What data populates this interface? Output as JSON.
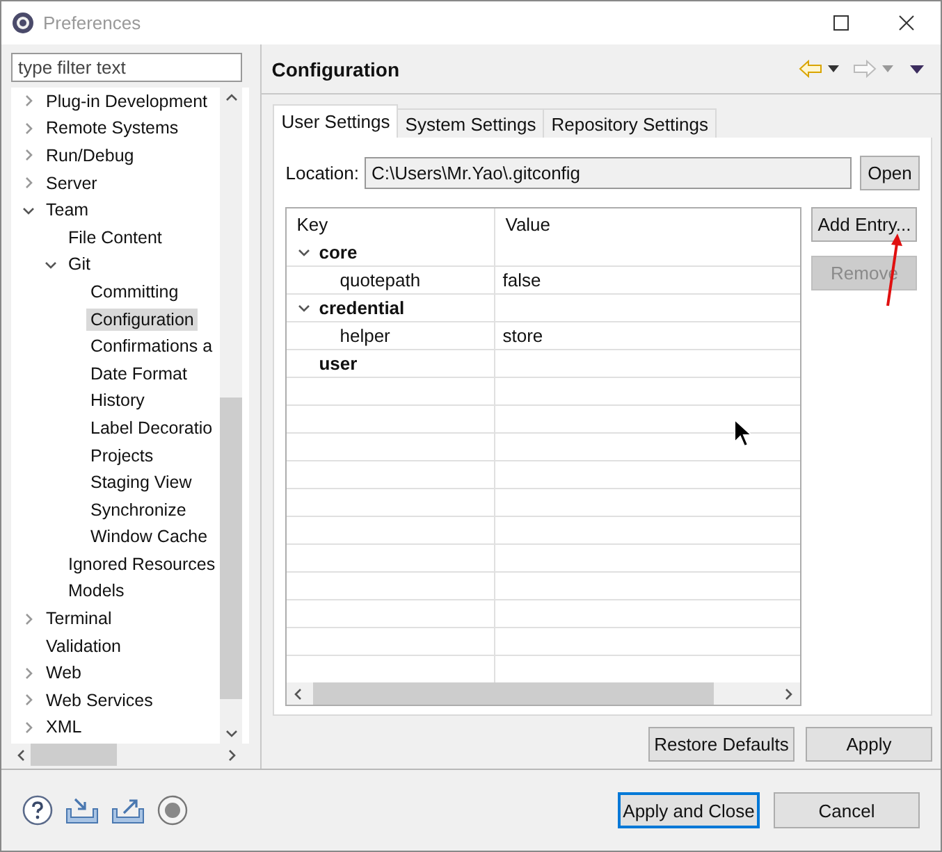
{
  "window": {
    "title": "Preferences"
  },
  "filter": {
    "placeholder": "type filter text"
  },
  "tree": [
    {
      "label": "Plug-in Development",
      "kind": "folder",
      "expanded": false,
      "selected": false
    },
    {
      "label": "Remote Systems",
      "kind": "folder",
      "expanded": false,
      "selected": false
    },
    {
      "label": "Run/Debug",
      "kind": "folder",
      "expanded": false,
      "selected": false
    },
    {
      "label": "Server",
      "kind": "folder",
      "expanded": false,
      "selected": false
    },
    {
      "label": "Team",
      "kind": "folder",
      "expanded": true,
      "selected": false,
      "children": [
        {
          "label": "File Content",
          "kind": "leaf",
          "selected": false
        },
        {
          "label": "Git",
          "kind": "folder",
          "expanded": true,
          "selected": false,
          "children": [
            {
              "label": "Committing",
              "kind": "leaf",
              "selected": false
            },
            {
              "label": "Configuration",
              "kind": "leaf",
              "selected": true
            },
            {
              "label": "Confirmations a",
              "kind": "leaf",
              "selected": false
            },
            {
              "label": "Date Format",
              "kind": "leaf",
              "selected": false
            },
            {
              "label": "History",
              "kind": "leaf",
              "selected": false
            },
            {
              "label": "Label Decoratio",
              "kind": "leaf",
              "selected": false
            },
            {
              "label": "Projects",
              "kind": "leaf",
              "selected": false
            },
            {
              "label": "Staging View",
              "kind": "leaf",
              "selected": false
            },
            {
              "label": "Synchronize",
              "kind": "leaf",
              "selected": false
            },
            {
              "label": "Window Cache",
              "kind": "leaf",
              "selected": false
            }
          ]
        },
        {
          "label": "Ignored Resources",
          "kind": "leaf",
          "selected": false
        },
        {
          "label": "Models",
          "kind": "leaf",
          "selected": false
        }
      ]
    },
    {
      "label": "Terminal",
      "kind": "folder",
      "expanded": false,
      "selected": false
    },
    {
      "label": "Validation",
      "kind": "leaf",
      "selected": false
    },
    {
      "label": "Web",
      "kind": "folder",
      "expanded": false,
      "selected": false
    },
    {
      "label": "Web Services",
      "kind": "folder",
      "expanded": false,
      "selected": false
    },
    {
      "label": "XML",
      "kind": "folder",
      "expanded": false,
      "selected": false
    }
  ],
  "page": {
    "title": "Configuration"
  },
  "tabs": [
    {
      "label": "User Settings",
      "selected": true
    },
    {
      "label": "System Settings",
      "selected": false
    },
    {
      "label": "Repository Settings",
      "selected": false
    }
  ],
  "location": {
    "label": "Location:",
    "value": "C:\\Users\\Mr.Yao\\.gitconfig",
    "button": "Open"
  },
  "table": {
    "columns": [
      "Key",
      "Value"
    ],
    "rows": [
      {
        "kind": "section",
        "key": "core",
        "expanded": true
      },
      {
        "kind": "entry",
        "key": "quotepath",
        "value": "false"
      },
      {
        "kind": "section",
        "key": "credential",
        "expanded": true
      },
      {
        "kind": "entry",
        "key": "helper",
        "value": "store"
      },
      {
        "kind": "empty-section",
        "key": "user"
      }
    ]
  },
  "side_buttons": [
    {
      "label": "Add Entry...",
      "disabled": false
    },
    {
      "label": "Remove",
      "disabled": true
    }
  ],
  "page_buttons": [
    "Restore Defaults",
    "Apply"
  ],
  "dialog_buttons": [
    {
      "label": "Apply and Close",
      "default": true
    },
    {
      "label": "Cancel",
      "default": false
    }
  ]
}
